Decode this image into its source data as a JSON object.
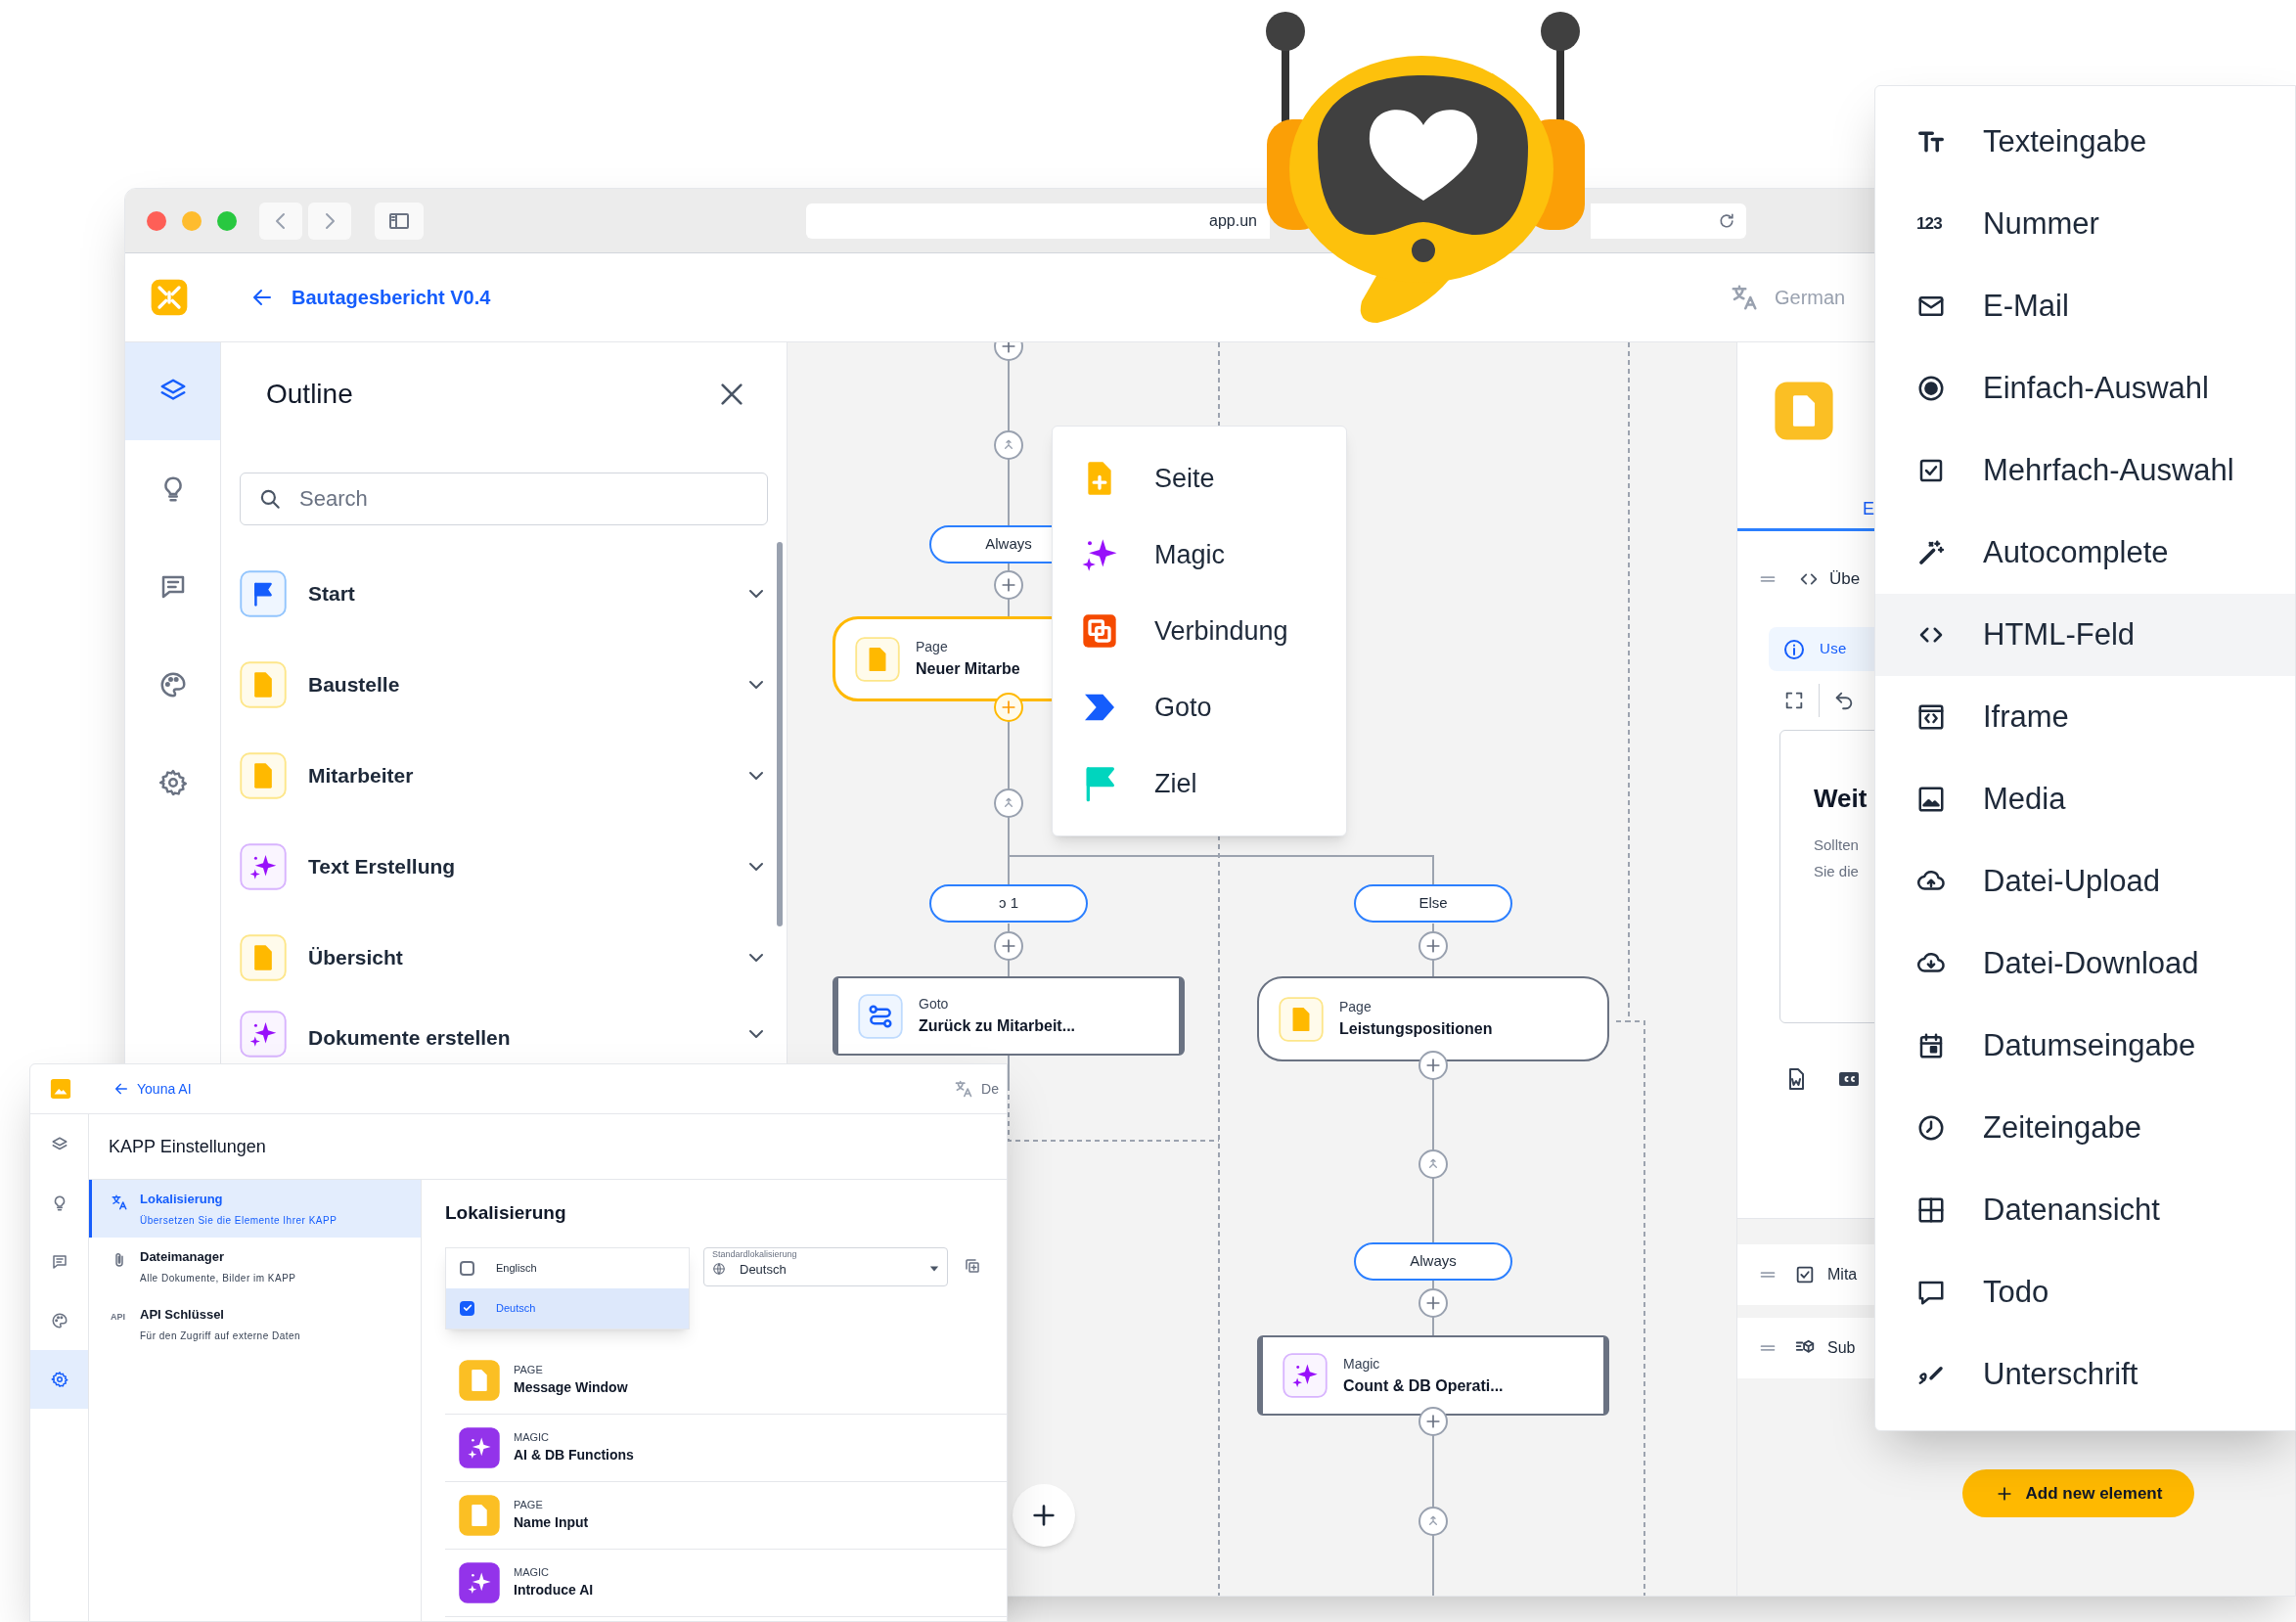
{
  "browser": {
    "url": "app.un"
  },
  "header": {
    "title": "Bautagesbericht V0.4",
    "language": "German"
  },
  "rail": [
    {
      "kind": "layers",
      "selected": true
    },
    {
      "kind": "ideas",
      "selected": false
    },
    {
      "kind": "comments",
      "selected": false
    },
    {
      "kind": "theme",
      "selected": false
    },
    {
      "kind": "settings",
      "selected": false
    }
  ],
  "outline": {
    "title": "Outline",
    "search": {
      "placeholder": "Search"
    },
    "items": [
      {
        "kind": "start",
        "label": "Start"
      },
      {
        "kind": "page",
        "label": "Baustelle"
      },
      {
        "kind": "page",
        "label": "Mitarbeiter"
      },
      {
        "kind": "magic",
        "label": "Text Erstellung"
      },
      {
        "kind": "page",
        "label": "Übersicht"
      },
      {
        "kind": "magic",
        "label": "Dokumente erstellen"
      }
    ]
  },
  "flow": {
    "pills": [
      {
        "label": "Always"
      },
      {
        "label": "ↄ 1"
      },
      {
        "label": "Else"
      },
      {
        "label": "Always"
      }
    ],
    "nodes": [
      {
        "kind": "page",
        "type_label": "Page",
        "title": "Neuer Mitarbe",
        "selected": true
      },
      {
        "kind": "goto",
        "type_label": "Goto",
        "title": "Zurück zu Mitarbeit...",
        "selected": false
      },
      {
        "kind": "page",
        "type_label": "Page",
        "title": "Leistungspositionen",
        "selected": false
      },
      {
        "kind": "magic",
        "type_label": "Magic",
        "title": "Count & DB Operati...",
        "selected": false
      }
    ],
    "add_menu": [
      {
        "kind": "page",
        "label": "Seite"
      },
      {
        "kind": "magic",
        "label": "Magic"
      },
      {
        "kind": "connection",
        "label": "Verbindung"
      },
      {
        "kind": "goto",
        "label": "Goto"
      },
      {
        "kind": "goal",
        "label": "Ziel"
      }
    ]
  },
  "element_panel": {
    "tab": "E",
    "field": "Übe",
    "info": "Use",
    "card": {
      "title": "Weit",
      "lines": [
        "Sollten",
        "Sie die"
      ]
    },
    "fields": [
      {
        "kind": "checkbox",
        "label": "Mita"
      },
      {
        "kind": "subform",
        "label": "Sub"
      }
    ],
    "add_button": "Add new element"
  },
  "element_menu": [
    {
      "kind": "text",
      "label": "Texteingabe",
      "selected": false
    },
    {
      "kind": "number",
      "icon_text": "123",
      "label": "Nummer",
      "selected": false
    },
    {
      "kind": "email",
      "label": "E-Mail",
      "selected": false
    },
    {
      "kind": "radio",
      "label": "Einfach-Auswahl",
      "selected": false
    },
    {
      "kind": "checkbox",
      "label": "Mehrfach-Auswahl",
      "selected": false
    },
    {
      "kind": "autocomplete",
      "label": "Autocomplete",
      "selected": false
    },
    {
      "kind": "html",
      "label": "HTML-Feld",
      "selected": true
    },
    {
      "kind": "iframe",
      "label": "Iframe",
      "selected": false
    },
    {
      "kind": "media",
      "label": "Media",
      "selected": false
    },
    {
      "kind": "upload",
      "label": "Datei-Upload",
      "selected": false
    },
    {
      "kind": "download",
      "label": "Datei-Download",
      "selected": false
    },
    {
      "kind": "date",
      "label": "Datumseingabe",
      "selected": false
    },
    {
      "kind": "time",
      "label": "Zeiteingabe",
      "selected": false
    },
    {
      "kind": "table",
      "label": "Datenansicht",
      "selected": false
    },
    {
      "kind": "todo",
      "label": "Todo",
      "selected": false
    },
    {
      "kind": "signature",
      "label": "Unterschrift",
      "selected": false
    }
  ],
  "settings_window": {
    "app_title": "Youna AI",
    "language": "De",
    "title": "KAPP Einstellungen",
    "rail": [
      {
        "kind": "layers",
        "selected": false
      },
      {
        "kind": "ideas",
        "selected": false
      },
      {
        "kind": "comments",
        "selected": false
      },
      {
        "kind": "theme",
        "selected": false
      },
      {
        "kind": "settings",
        "selected": true
      }
    ],
    "sections": [
      {
        "kind": "localization",
        "title": "Lokalisierung",
        "subtitle": "Übersetzen Sie die Elemente Ihrer KAPP",
        "selected": true
      },
      {
        "kind": "files",
        "title": "Dateimanager",
        "subtitle": "Alle Dokumente, Bilder im KAPP",
        "selected": false
      },
      {
        "kind": "api",
        "icon_text": "API",
        "title": "API Schlüssel",
        "subtitle": "Für den Zugriff auf externe Daten",
        "selected": false
      }
    ],
    "heading": "Lokalisierung",
    "languages": [
      {
        "label": "Englisch",
        "checked": false
      },
      {
        "label": "Deutsch",
        "checked": true
      }
    ],
    "default_locale": {
      "label": "Standardlokalisierung",
      "value": "Deutsch"
    },
    "elements": [
      {
        "kind": "page",
        "type_label": "PAGE",
        "title": "Message Window"
      },
      {
        "kind": "magic",
        "type_label": "MAGIC",
        "title": "AI & DB Functions"
      },
      {
        "kind": "page",
        "type_label": "PAGE",
        "title": "Name Input"
      },
      {
        "kind": "magic",
        "type_label": "MAGIC",
        "title": "Introduce AI"
      }
    ]
  }
}
